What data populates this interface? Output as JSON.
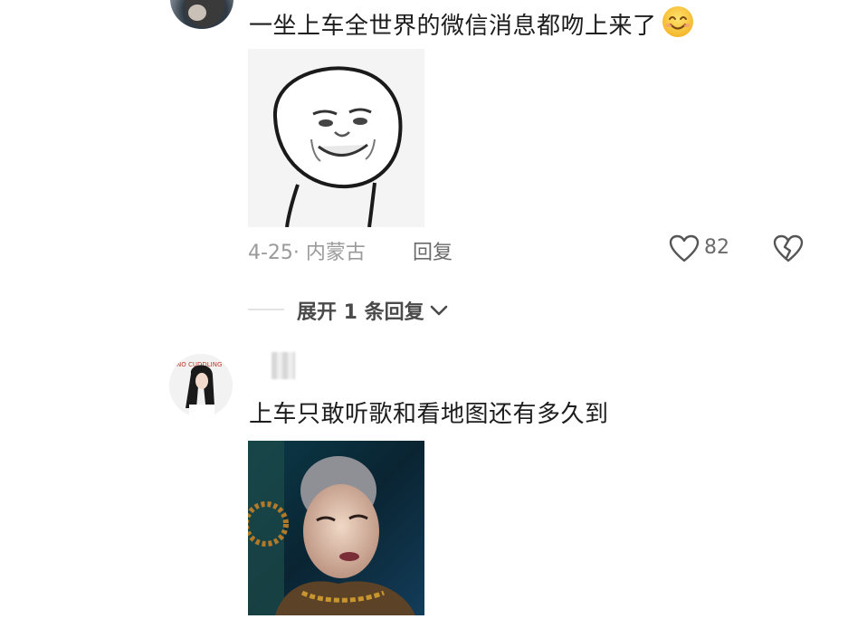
{
  "comments": [
    {
      "text": "一坐上车全世界的微信消息都吻上来了",
      "emoji": "smiling-face-emoji",
      "sticker": "meme-sticker-image",
      "date_location": "4-25· 内蒙古",
      "reply_label": "回复",
      "likes": "82",
      "expand_label": "展开 1 条回复"
    },
    {
      "text": "上车只敢听歌和看地图还有多久到",
      "image": "monk-portrait-image"
    }
  ],
  "icons": {
    "like": "heart-icon",
    "dislike": "broken-heart-icon",
    "expand": "chevron-down-icon"
  },
  "colors": {
    "text_primary": "#1d1d1d",
    "text_meta": "#9a9a9a",
    "text_secondary": "#6a6a6a",
    "background": "#ffffff"
  }
}
